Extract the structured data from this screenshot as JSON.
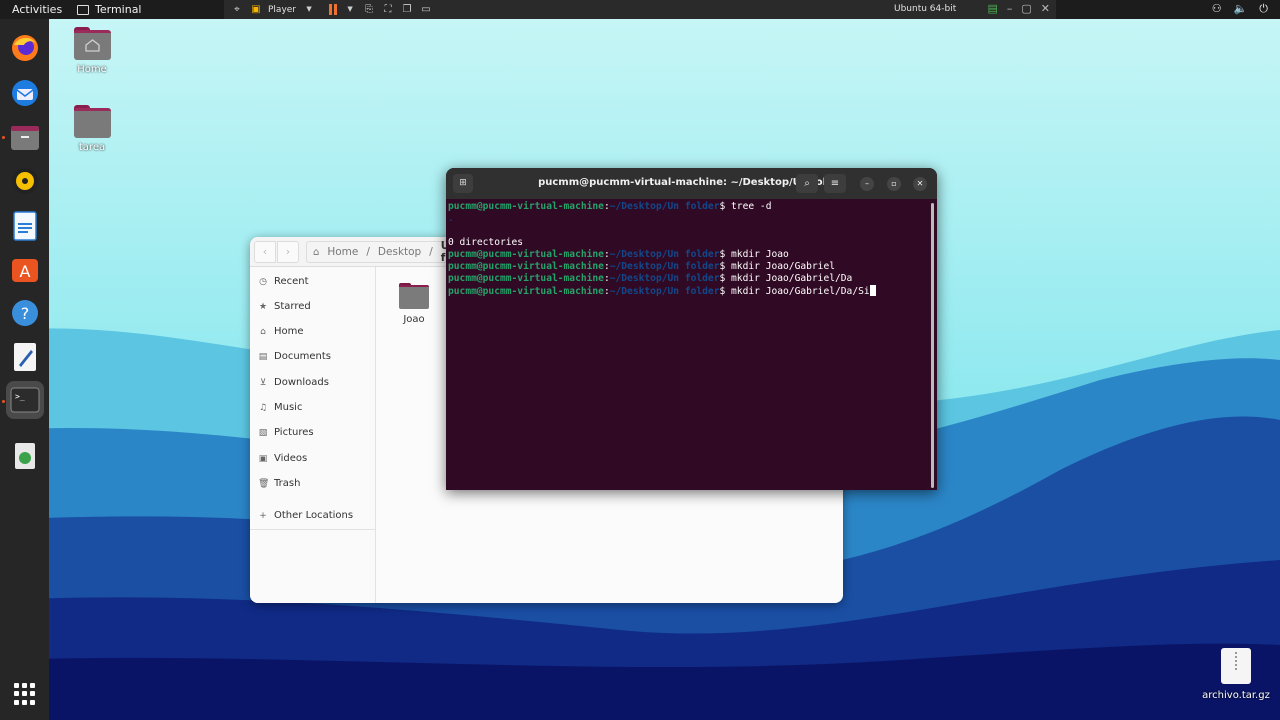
{
  "topbar": {
    "activities": "Activities",
    "app_name": "Terminal",
    "player_label": "Player",
    "vm_name": "Ubuntu 64-bit"
  },
  "dock": {
    "items": [
      {
        "icon": "firefox-icon"
      },
      {
        "icon": "thunderbird-icon"
      },
      {
        "icon": "files-icon"
      },
      {
        "icon": "rhythmbox-icon"
      },
      {
        "icon": "writer-icon"
      },
      {
        "icon": "software-icon"
      },
      {
        "icon": "help-icon"
      },
      {
        "icon": "text-editor-icon"
      },
      {
        "icon": "terminal-icon"
      },
      {
        "icon": "trash-icon"
      }
    ]
  },
  "desktop": {
    "icons": [
      {
        "label": "Home"
      },
      {
        "label": "tarea"
      }
    ],
    "archive": {
      "label": "archivo.tar.gz"
    }
  },
  "files": {
    "path": [
      "Home",
      "Desktop",
      "Un f"
    ],
    "sidebar": [
      {
        "label": "Recent",
        "icon": "clock-icon"
      },
      {
        "label": "Starred",
        "icon": "star-icon"
      },
      {
        "label": "Home",
        "icon": "home-icon"
      },
      {
        "label": "Documents",
        "icon": "document-icon"
      },
      {
        "label": "Downloads",
        "icon": "download-icon"
      },
      {
        "label": "Music",
        "icon": "music-icon"
      },
      {
        "label": "Pictures",
        "icon": "picture-icon"
      },
      {
        "label": "Videos",
        "icon": "video-icon"
      },
      {
        "label": "Trash",
        "icon": "trash-icon"
      },
      {
        "label": "Other Locations",
        "icon": "plus-icon"
      }
    ],
    "items": [
      {
        "label": "Joao"
      }
    ]
  },
  "terminal": {
    "title": "pucmm@pucmm-virtual-machine: ~/Desktop/Un folder",
    "prompt_user": "pucmm@pucmm-virtual-machine",
    "prompt_path": "~/Desktop/Un folder",
    "lines": [
      {
        "type": "prompt",
        "cmd": "tree -d"
      },
      {
        "type": "output",
        "text": "."
      },
      {
        "type": "output",
        "text": ""
      },
      {
        "type": "output",
        "text": "0 directories"
      },
      {
        "type": "prompt",
        "cmd": "mkdir Joao"
      },
      {
        "type": "prompt",
        "cmd": "mkdir Joao/Gabriel"
      },
      {
        "type": "prompt",
        "cmd": "mkdir Joao/Gabriel/Da"
      },
      {
        "type": "prompt",
        "cmd": "mkdir Joao/Gabriel/Da/Si",
        "cursor": true
      }
    ]
  },
  "colors": {
    "terminal_bg": "#300a24",
    "prompt_user": "#26a269",
    "prompt_path": "#12488b",
    "accent": "#e95420"
  }
}
